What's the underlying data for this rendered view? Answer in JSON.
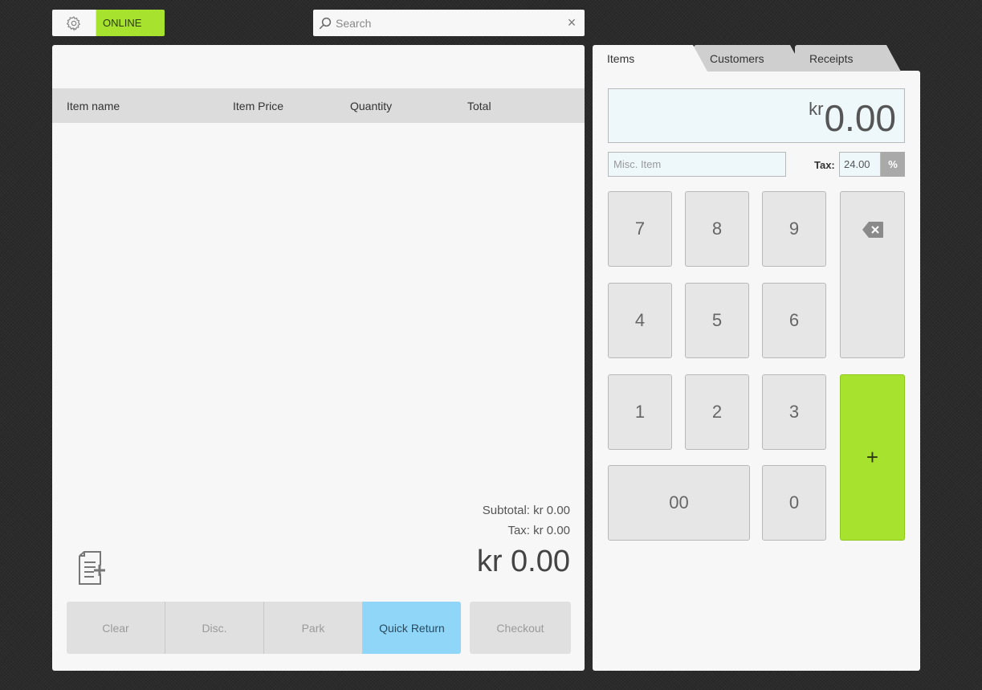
{
  "topbar": {
    "status": "ONLINE",
    "search_placeholder": "Search",
    "search_clear": "×"
  },
  "cart": {
    "columns": [
      "Item name",
      "Item Price",
      "Quantity",
      "Total"
    ],
    "subtotal_label": "Subtotal:",
    "subtotal_value": "kr 0.00",
    "tax_label": "Tax:",
    "tax_value": "kr 0.00",
    "grand_total": "kr 0.00",
    "actions": {
      "clear": "Clear",
      "discount": "Disc.",
      "park": "Park",
      "quick_return": "Quick Return",
      "checkout": "Checkout"
    }
  },
  "tabs": [
    "Items",
    "Customers",
    "Receipts"
  ],
  "keypad": {
    "currency": "kr",
    "amount": "0.00",
    "misc_placeholder": "Misc. Item",
    "tax_label": "Tax:",
    "tax_value": "24.00",
    "percent": "%",
    "keys": [
      "7",
      "8",
      "9",
      "4",
      "5",
      "6",
      "1",
      "2",
      "3",
      "00",
      "0"
    ],
    "plus": "+"
  },
  "colors": {
    "online_green": "#a6e22e",
    "quick_return_blue": "#8fd6f9",
    "background": "#2b2b2b"
  }
}
